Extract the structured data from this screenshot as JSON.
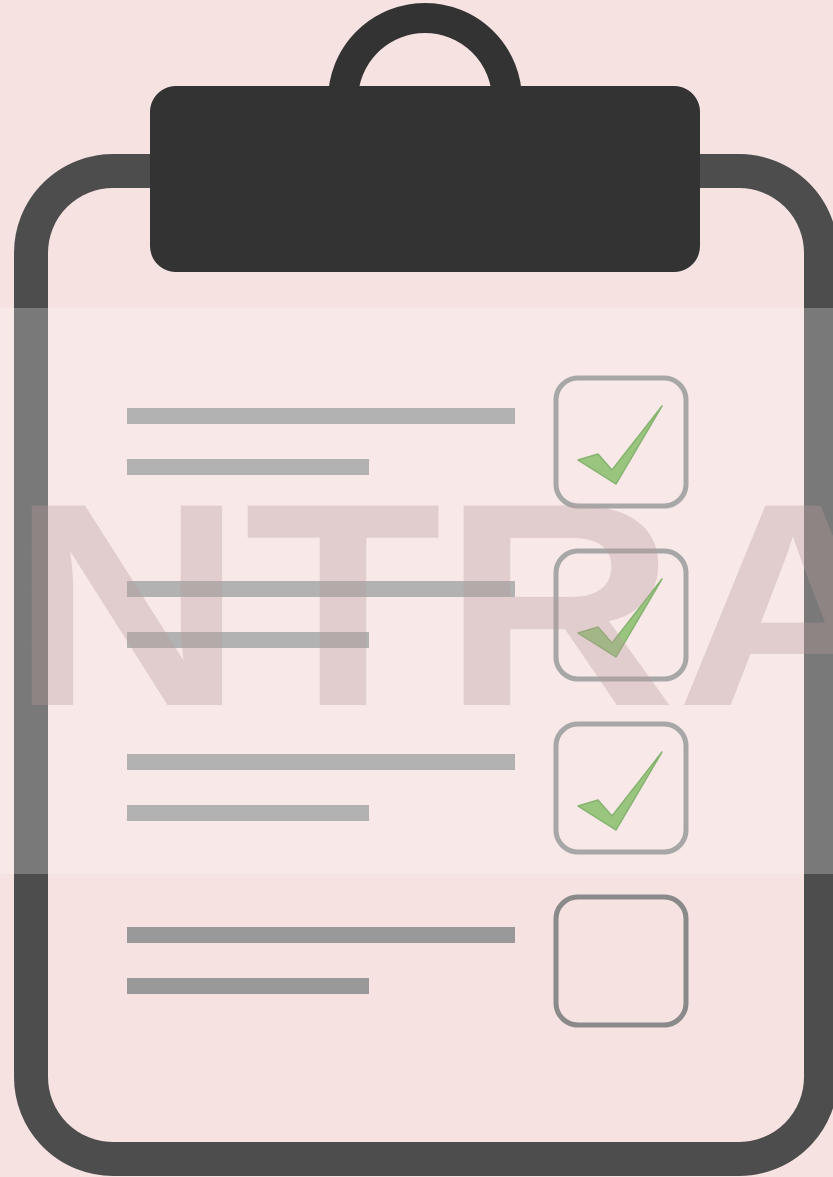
{
  "colors": {
    "background": "#f6e2e1",
    "board_frame": "#4d4d4d",
    "clip": "#333333",
    "text_line": "#999999",
    "checkbox_border": "#8a8a8a",
    "check_mark": "#77b255",
    "watermark_band": "#ffffff",
    "watermark_text": "#c8b0b0"
  },
  "checklist": {
    "items": [
      {
        "checked": true,
        "check_icon": "checkmark-icon"
      },
      {
        "checked": true,
        "check_icon": "checkmark-icon"
      },
      {
        "checked": true,
        "check_icon": "checkmark-icon"
      },
      {
        "checked": false,
        "check_icon": ""
      }
    ]
  },
  "watermark": {
    "text": "NTRA"
  }
}
